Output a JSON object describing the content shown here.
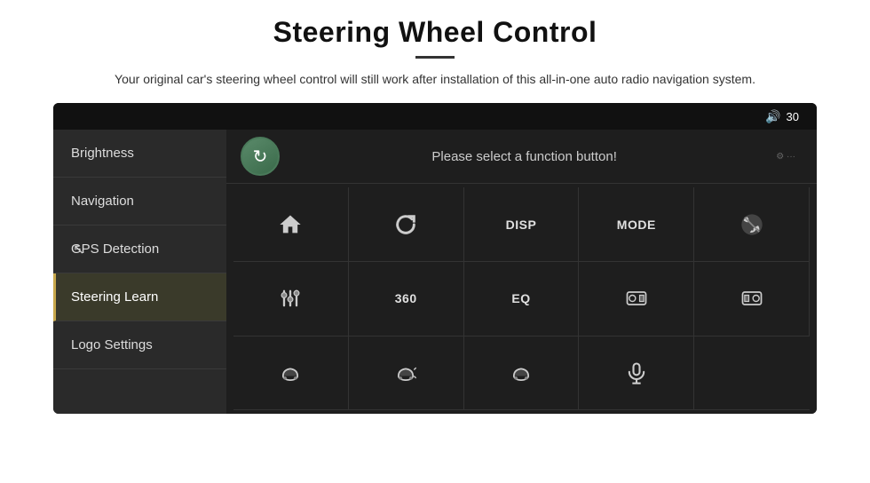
{
  "header": {
    "title": "Steering Wheel Control",
    "divider": true,
    "subtitle": "Your original car's steering wheel control will still work after installation of this all-in-one auto radio navigation system."
  },
  "device": {
    "topbar": {
      "volume_icon": "🔊",
      "volume_value": "30"
    },
    "sidebar": {
      "items": [
        {
          "label": "Brightness",
          "active": false
        },
        {
          "label": "Navigation",
          "active": false
        },
        {
          "label": "GPS Detection",
          "active": false
        },
        {
          "label": "Steering Learn",
          "active": true
        },
        {
          "label": "Logo Settings",
          "active": false
        }
      ]
    },
    "function_panel": {
      "prompt": "Please select a function button!",
      "refresh_label": "↻",
      "top_right": "···",
      "grid": [
        {
          "id": "home",
          "type": "icon",
          "symbol": "⌂"
        },
        {
          "id": "back",
          "type": "icon",
          "symbol": "↺"
        },
        {
          "id": "disp",
          "type": "text",
          "symbol": "DISP"
        },
        {
          "id": "mode",
          "type": "text",
          "symbol": "MODE"
        },
        {
          "id": "phone-slash",
          "type": "svg",
          "symbol": "phone-slash"
        },
        {
          "id": "tune",
          "type": "svg",
          "symbol": "tune"
        },
        {
          "id": "360",
          "type": "text",
          "symbol": "360"
        },
        {
          "id": "eq",
          "type": "text",
          "symbol": "EQ"
        },
        {
          "id": "car-front-1",
          "type": "svg",
          "symbol": "car-front"
        },
        {
          "id": "car-front-2",
          "type": "svg",
          "symbol": "car-front-r"
        },
        {
          "id": "car-top-1",
          "type": "svg",
          "symbol": "car-top"
        },
        {
          "id": "car-top-2",
          "type": "svg",
          "symbol": "car-top-r"
        },
        {
          "id": "car-top-3",
          "type": "svg",
          "symbol": "car-top-m"
        },
        {
          "id": "mic",
          "type": "svg",
          "symbol": "mic"
        },
        {
          "id": "empty",
          "type": "empty",
          "symbol": ""
        }
      ]
    }
  }
}
